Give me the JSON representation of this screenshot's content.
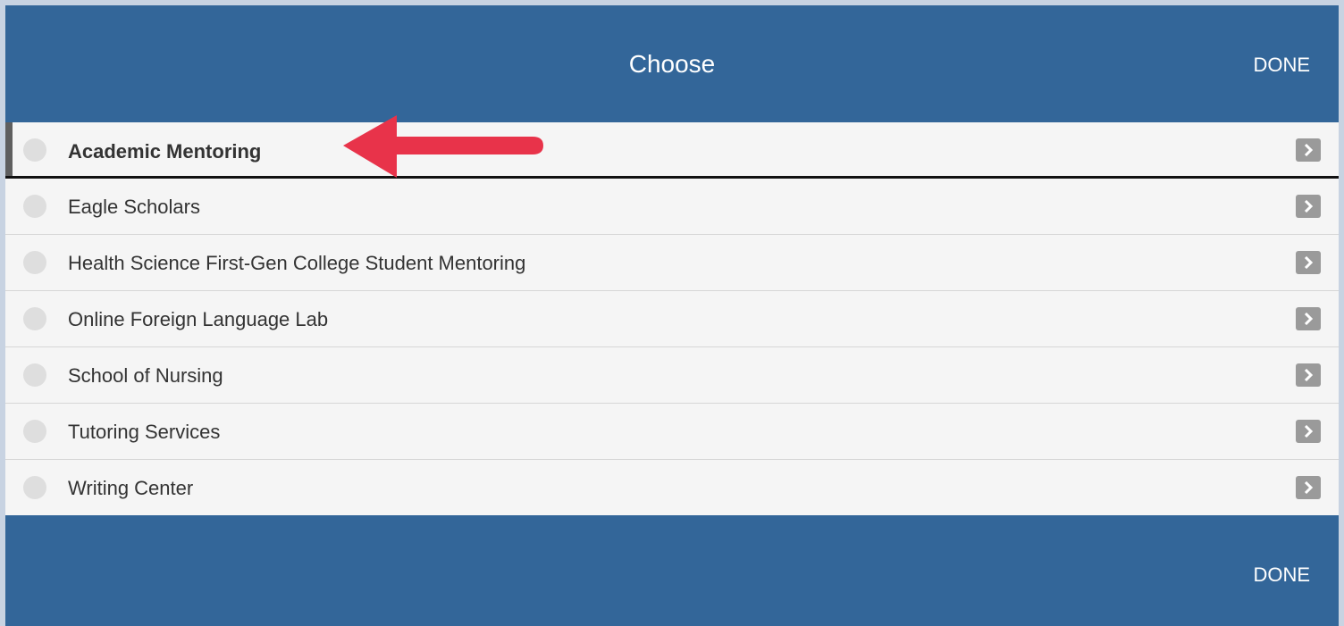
{
  "header": {
    "title": "Choose",
    "done_label": "DONE"
  },
  "footer": {
    "done_label": "DONE"
  },
  "options": [
    {
      "label": "Academic Mentoring",
      "selected": true
    },
    {
      "label": "Eagle Scholars",
      "selected": false
    },
    {
      "label": "Health Science First-Gen College Student Mentoring",
      "selected": false
    },
    {
      "label": "Online Foreign Language Lab",
      "selected": false
    },
    {
      "label": "School of Nursing",
      "selected": false
    },
    {
      "label": "Tutoring Services",
      "selected": false
    },
    {
      "label": "Writing Center",
      "selected": false
    }
  ],
  "icons": {
    "row_indicator": "radio-circle-icon",
    "row_action": "chevron-right-icon",
    "annotation": "red-arrow-icon"
  },
  "colors": {
    "primary": "#336699",
    "list_background": "#f5f5f5",
    "annotation": "#e8334a",
    "chevron_button": "#9a9a9a"
  }
}
